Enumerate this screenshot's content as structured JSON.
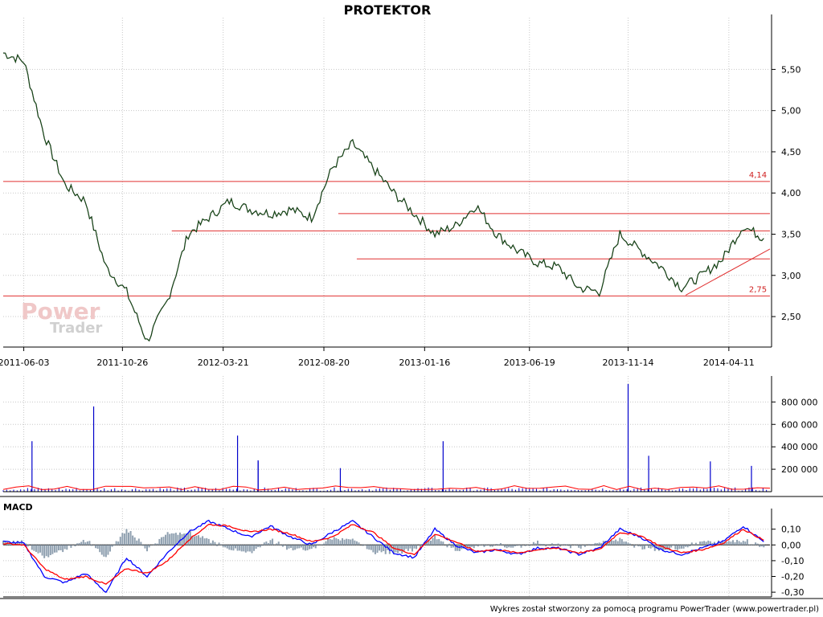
{
  "title": "PROTEKTOR",
  "footer": "Wykres został stworzony za pomocą programu PowerTrader (www.powertrader.pl)",
  "watermark": {
    "line1": "Power",
    "line2": "Trader"
  },
  "colors": {
    "price": "#000000",
    "price_trend": "#1f8a1f",
    "level": "#e03030",
    "volume": "#0000cc",
    "volume_avg": "#ff0000",
    "macd": "#0000ff",
    "signal": "#ff0000",
    "hist": "#8fa0b0",
    "grid": "#c8c8c8"
  },
  "chart_data": [
    {
      "type": "line",
      "name": "price",
      "x_tick_labels": [
        "2011-06-03",
        "2011-10-26",
        "2012-03-21",
        "2012-08-20",
        "2013-01-16",
        "2013-06-19",
        "2013-11-14",
        "2014-04-11"
      ],
      "y_tick_labels": [
        "5,50",
        "5,00",
        "4,50",
        "4,00",
        "3,50",
        "3,00",
        "2,50"
      ],
      "y_ticks": [
        5.5,
        5.0,
        4.5,
        4.0,
        3.5,
        3.0,
        2.5
      ],
      "ylim": [
        2.13,
        6.05
      ],
      "x": [
        "2011-04",
        "2011-05",
        "2011-06",
        "2011-07",
        "2011-08",
        "2011-09",
        "2011-10",
        "2011-11",
        "2011-12",
        "2012-01",
        "2012-02",
        "2012-03",
        "2012-04",
        "2012-05",
        "2012-06",
        "2012-07",
        "2012-08",
        "2012-09",
        "2012-10",
        "2012-11",
        "2012-12",
        "2013-01",
        "2013-02",
        "2013-03",
        "2013-04",
        "2013-05",
        "2013-06",
        "2013-07",
        "2013-08",
        "2013-09",
        "2013-10",
        "2013-11",
        "2013-12",
        "2014-01",
        "2014-02",
        "2014-03",
        "2014-04",
        "2014-05"
      ],
      "values": [
        5.7,
        5.6,
        4.7,
        4.1,
        3.9,
        3.1,
        2.8,
        2.2,
        2.7,
        3.5,
        3.7,
        3.9,
        3.8,
        3.75,
        3.8,
        3.7,
        4.3,
        4.6,
        4.3,
        4.0,
        3.75,
        3.5,
        3.6,
        3.85,
        3.5,
        3.3,
        3.15,
        3.1,
        2.85,
        2.8,
        3.5,
        3.3,
        3.1,
        2.85,
        3.0,
        3.2,
        3.6,
        3.45
      ],
      "levels": [
        {
          "value": 4.14,
          "label": "4,14"
        },
        {
          "value": 3.75,
          "label": ""
        },
        {
          "value": 3.54,
          "label": ""
        },
        {
          "value": 3.2,
          "label": ""
        },
        {
          "value": 2.75,
          "label": "2,75"
        }
      ]
    },
    {
      "type": "bar",
      "name": "volume",
      "y_tick_labels": [
        "800 000",
        "600 000",
        "400 000",
        "200 000"
      ],
      "y_ticks": [
        800000,
        600000,
        400000,
        200000
      ],
      "ylim": [
        0,
        960000
      ],
      "spikes": [
        {
          "x": "2011-05",
          "value": 450000
        },
        {
          "x": "2011-08",
          "value": 760000
        },
        {
          "x": "2012-03",
          "value": 500000
        },
        {
          "x": "2012-04",
          "value": 280000
        },
        {
          "x": "2012-04",
          "value": 270000
        },
        {
          "x": "2012-08",
          "value": 210000
        },
        {
          "x": "2013-01",
          "value": 450000
        },
        {
          "x": "2013-10",
          "value": 960000
        },
        {
          "x": "2013-11",
          "value": 320000
        },
        {
          "x": "2014-02",
          "value": 270000
        },
        {
          "x": "2014-04",
          "value": 230000
        }
      ]
    },
    {
      "type": "line",
      "name": "MACD",
      "label": "MACD",
      "y_tick_labels": [
        "0,10",
        "0,00",
        "-0,10",
        "-0,20",
        "-0,30"
      ],
      "y_ticks": [
        0.1,
        0.0,
        -0.1,
        -0.2,
        -0.3
      ],
      "ylim": [
        -0.33,
        0.18
      ],
      "x": [
        "2011-04",
        "2011-05",
        "2011-06",
        "2011-07",
        "2011-08",
        "2011-09",
        "2011-10",
        "2011-11",
        "2011-12",
        "2012-01",
        "2012-02",
        "2012-03",
        "2012-04",
        "2012-05",
        "2012-06",
        "2012-07",
        "2012-08",
        "2012-09",
        "2012-10",
        "2012-11",
        "2012-12",
        "2013-01",
        "2013-02",
        "2013-03",
        "2013-04",
        "2013-05",
        "2013-06",
        "2013-07",
        "2013-08",
        "2013-09",
        "2013-10",
        "2013-11",
        "2013-12",
        "2014-01",
        "2014-02",
        "2014-03",
        "2014-04",
        "2014-05"
      ],
      "series": [
        {
          "name": "MACD",
          "values": [
            0.02,
            0.01,
            -0.2,
            -0.24,
            -0.18,
            -0.3,
            -0.08,
            -0.2,
            -0.05,
            0.08,
            0.15,
            0.1,
            0.05,
            0.12,
            0.05,
            0.0,
            0.08,
            0.15,
            0.05,
            -0.05,
            -0.08,
            0.1,
            0.0,
            -0.05,
            -0.03,
            -0.06,
            -0.02,
            -0.02,
            -0.06,
            -0.02,
            0.1,
            0.05,
            -0.03,
            -0.06,
            -0.02,
            0.02,
            0.12,
            0.02
          ]
        },
        {
          "name": "Signal",
          "values": [
            0.01,
            0.0,
            -0.15,
            -0.22,
            -0.2,
            -0.25,
            -0.15,
            -0.18,
            -0.1,
            0.03,
            0.13,
            0.12,
            0.08,
            0.1,
            0.07,
            0.02,
            0.05,
            0.13,
            0.08,
            -0.02,
            -0.06,
            0.07,
            0.02,
            -0.04,
            -0.03,
            -0.05,
            -0.03,
            -0.02,
            -0.05,
            -0.03,
            0.08,
            0.06,
            -0.01,
            -0.05,
            -0.03,
            0.01,
            0.1,
            0.03
          ]
        }
      ]
    }
  ]
}
